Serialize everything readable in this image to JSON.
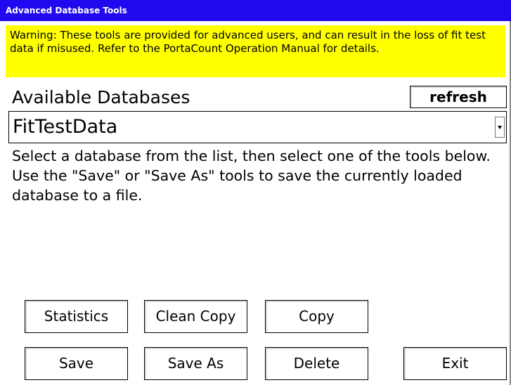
{
  "window": {
    "title": "Advanced Database Tools"
  },
  "warning": {
    "text": "Warning: These tools are provided for advanced users, and can result in the loss of fit test data if misused.  Refer to the PortaCount Operation Manual for details."
  },
  "databases": {
    "heading": "Available Databases",
    "refresh_label": "refresh",
    "selected": "FitTestData",
    "dropdown_icon": "chevron-down-icon"
  },
  "instructions": {
    "text": "Select a database from the list, then select one of the tools below.  Use the \"Save\" or \"Save As\" tools to save the currently loaded database to a file."
  },
  "buttons": {
    "statistics": "Statistics",
    "clean_copy": "Clean Copy",
    "copy": "Copy",
    "save": "Save",
    "save_as": "Save As",
    "delete": "Delete",
    "exit": "Exit"
  },
  "colors": {
    "titlebar": "#2208ee",
    "warning_background": "#ffff00"
  }
}
